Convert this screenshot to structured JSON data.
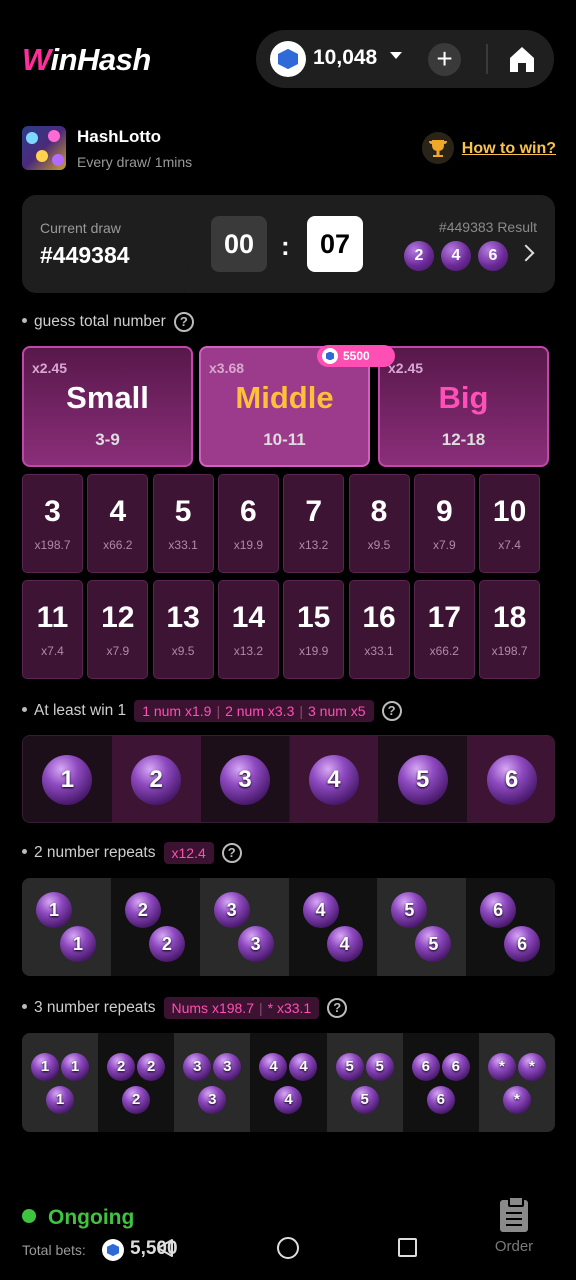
{
  "header": {
    "logo_w": "W",
    "logo_rest": "inHash",
    "balance": "10,048"
  },
  "game": {
    "title": "HashLotto",
    "subtitle": "Every draw/ 1mins",
    "how_to_win": "How to win?"
  },
  "draw": {
    "current_label": "Current draw",
    "current_number": "#449384",
    "timer_min": "00",
    "timer_sep": ":",
    "timer_sec": "07",
    "result_label": "#449383 Result",
    "result_balls": [
      "2",
      "4",
      "6"
    ]
  },
  "guess": {
    "label": "guess total number",
    "options": [
      {
        "mult": "x2.45",
        "name": "Small",
        "range": "3-9"
      },
      {
        "mult": "x3.68",
        "name": "Middle",
        "range": "10-11"
      },
      {
        "mult": "x2.45",
        "name": "Big",
        "range": "12-18"
      }
    ],
    "middle_badge": "5500",
    "numbers": [
      {
        "n": "3",
        "m": "x198.7"
      },
      {
        "n": "4",
        "m": "x66.2"
      },
      {
        "n": "5",
        "m": "x33.1"
      },
      {
        "n": "6",
        "m": "x19.9"
      },
      {
        "n": "7",
        "m": "x13.2"
      },
      {
        "n": "8",
        "m": "x9.5"
      },
      {
        "n": "9",
        "m": "x7.9"
      },
      {
        "n": "10",
        "m": "x7.4"
      },
      {
        "n": "11",
        "m": "x7.4"
      },
      {
        "n": "12",
        "m": "x7.9"
      },
      {
        "n": "13",
        "m": "x9.5"
      },
      {
        "n": "14",
        "m": "x13.2"
      },
      {
        "n": "15",
        "m": "x19.9"
      },
      {
        "n": "16",
        "m": "x33.1"
      },
      {
        "n": "17",
        "m": "x66.2"
      },
      {
        "n": "18",
        "m": "x198.7"
      }
    ]
  },
  "atleast": {
    "label": "At least win 1",
    "pills": [
      "1 num x1.9",
      "2 num x3.3",
      "3 num x5"
    ],
    "balls": [
      "1",
      "2",
      "3",
      "4",
      "5",
      "6"
    ]
  },
  "two_repeat": {
    "label": "2 number repeats",
    "pill": "x12.4",
    "groups": [
      "1",
      "2",
      "3",
      "4",
      "5",
      "6"
    ]
  },
  "three_repeat": {
    "label": "3 number repeats",
    "pills": [
      "Nums x198.7",
      "* x33.1"
    ],
    "groups": [
      "1",
      "2",
      "3",
      "4",
      "5",
      "6",
      "*"
    ]
  },
  "footer": {
    "status": "Ongoing",
    "total_label": "Total bets:",
    "total_value": "5,500",
    "order_label": "Order"
  },
  "colors": {
    "accent_pink": "#ff2e9a",
    "gold": "#f7c34b",
    "green": "#3fc43f"
  }
}
